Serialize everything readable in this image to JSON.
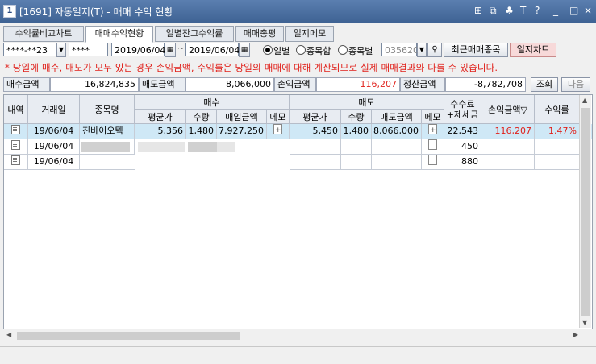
{
  "window": {
    "num_badge": "1",
    "title": "[1691] 자동일지(T) - 매매 수익 현황",
    "controls": [
      "⊞",
      "⧉",
      "♣",
      "T",
      "?",
      "_",
      "□",
      "×"
    ]
  },
  "tabs": [
    "수익률비교차트",
    "매매수익현황",
    "일별잔고수익률",
    "매매총평",
    "일지메모"
  ],
  "active_tab": "매매수익현황",
  "controls": {
    "account": "****-**23",
    "password": "****",
    "date_from": "2019/06/04",
    "date_to": "2019/06/04",
    "radio": [
      "일별",
      "종목합",
      "종목별"
    ],
    "radio_selected": "일별",
    "stock_code": "035620",
    "recent_btn": "최근매매종목",
    "chart_btn": "일지차트"
  },
  "notice": "* 당일에 매수, 매도가 모두 있는 경우 손익금액, 수익률은 당일의 매매에 대해 계산되므로 실제 매매결과와 다를 수 있습니다.",
  "summary": {
    "buy_label": "매수금액",
    "buy_value": "16,824,835",
    "sell_label": "매도금액",
    "sell_value": "8,066,000",
    "pnl_label": "손익금액",
    "pnl_value": "116,207",
    "settle_label": "정산금액",
    "settle_value": "-8,782,708",
    "query_btn": "조회",
    "next_btn": "다음"
  },
  "table": {
    "headers": {
      "kind": "내역",
      "date": "거래일",
      "name": "종목명",
      "buy_group": "매수",
      "sell_group": "매도",
      "avg": "평균가",
      "qty": "수량",
      "buy_amt": "매입금액",
      "memo": "메모",
      "sell_amt": "매도금액",
      "fee": "수수료\n+제세금",
      "pnl": "손익금액▽",
      "rate": "수익률"
    },
    "rows": [
      {
        "date": "19/06/04",
        "name": "진바이오텍",
        "buy_avg": "5,356",
        "buy_qty": "1,480",
        "buy_amt": "7,927,250",
        "sell_avg": "5,450",
        "sell_qty": "1,480",
        "sell_amt": "8,066,000",
        "fee": "22,543",
        "pnl": "116,207",
        "rate": "1.47%"
      },
      {
        "date": "19/06/04",
        "name": "",
        "buy_avg": "",
        "buy_qty": "",
        "buy_amt": "",
        "sell_avg": "",
        "sell_qty": "",
        "sell_amt": "",
        "fee": "450",
        "pnl": "",
        "rate": ""
      },
      {
        "date": "19/06/04",
        "name": "",
        "buy_avg": "",
        "buy_qty": "",
        "buy_amt": "",
        "sell_avg": "",
        "sell_qty": "",
        "sell_amt": "",
        "fee": "880",
        "pnl": "",
        "rate": ""
      }
    ]
  },
  "colors": {
    "title_bar": "#4a6fa0",
    "selected_row": "#cfe8f6",
    "accent_red": "#e0201a"
  }
}
